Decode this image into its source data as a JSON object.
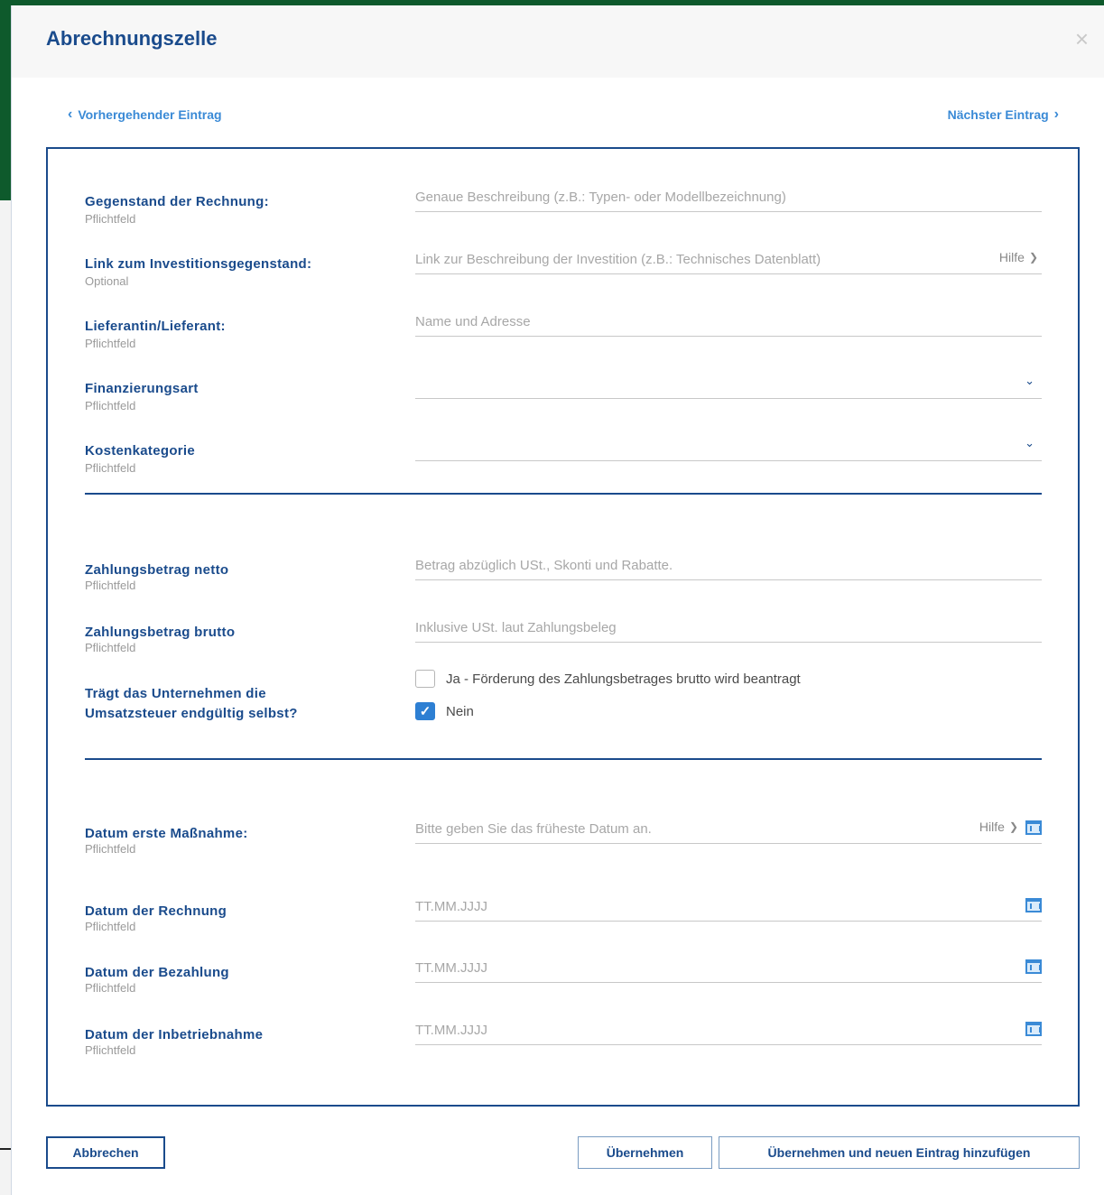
{
  "dialog": {
    "title": "Abrechnungszelle",
    "close_label": "×"
  },
  "nav": {
    "prev_label": "Vorhergehender Eintrag",
    "next_label": "Nächster Eintrag"
  },
  "section1": [
    {
      "label": "Gegenstand der Rechnung:",
      "sub": "Pflichtfeld",
      "placeholder": "Genaue Beschreibung (z.B.: Typen- oder Modellbezeichnung)",
      "type": "text"
    },
    {
      "label": "Link zum Investitionsgegenstand:",
      "sub": "Optional",
      "placeholder": "Link zur Beschreibung der Investition (z.B.: Technisches Datenblatt)",
      "type": "text",
      "help": "Hilfe"
    },
    {
      "label": "Lieferantin/Lieferant:",
      "sub": "Pflichtfeld",
      "placeholder": "Name und Adresse",
      "type": "text"
    },
    {
      "label": "Finanzierungsart",
      "sub": "Pflichtfeld",
      "placeholder": "",
      "type": "select"
    },
    {
      "label": "Kostenkategorie",
      "sub": "Pflichtfeld",
      "placeholder": "",
      "type": "select"
    }
  ],
  "section2": [
    {
      "label": "Zahlungsbetrag netto",
      "sub": "Pflichtfeld",
      "placeholder": "Betrag abzüglich USt., Skonti und Rabatte."
    },
    {
      "label": "Zahlungsbetrag brutto",
      "sub": "Pflichtfeld",
      "placeholder": "Inklusive USt. laut Zahlungsbeleg"
    }
  ],
  "vat_question": {
    "label_line1": "Trägt das Unternehmen die",
    "label_line2": "Umsatzsteuer endgültig selbst?",
    "options": [
      {
        "label": "Ja - Förderung des Zahlungsbetrages brutto wird beantragt",
        "checked": false
      },
      {
        "label": "Nein",
        "checked": true
      }
    ]
  },
  "section3": [
    {
      "label": "Datum erste Maßnahme:",
      "sub": "Pflichtfeld",
      "placeholder": "Bitte geben Sie das früheste Datum an.",
      "help": "Hilfe"
    },
    {
      "label": "Datum der Rechnung",
      "sub": "Pflichtfeld",
      "placeholder": "TT.MM.JJJJ"
    },
    {
      "label": "Datum der Bezahlung",
      "sub": "Pflichtfeld",
      "placeholder": "TT.MM.JJJJ"
    },
    {
      "label": "Datum der Inbetriebnahme",
      "sub": "Pflichtfeld",
      "placeholder": "TT.MM.JJJJ"
    }
  ],
  "footer": {
    "cancel_label": "Abbrechen",
    "apply_label": "Übernehmen",
    "apply_new_label": "Übernehmen und neuen Eintrag hinzufügen"
  },
  "colors": {
    "primary": "#1a4b8c",
    "link": "#3a8ad6",
    "checkbox_checked": "#2d7fd3",
    "background_header": "#0e5a2c"
  }
}
